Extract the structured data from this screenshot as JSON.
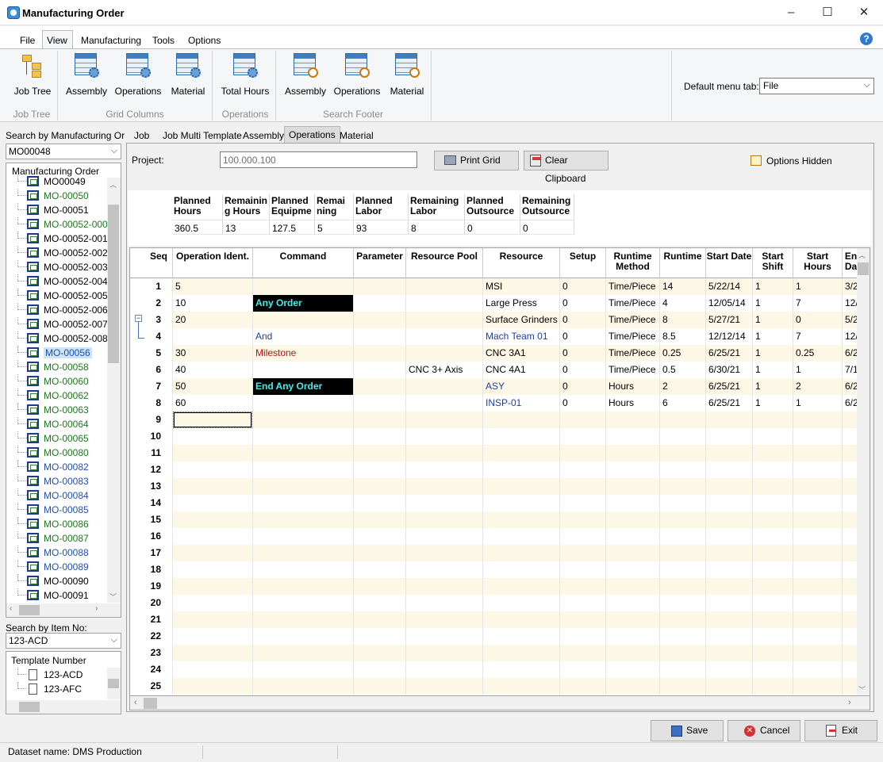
{
  "window": {
    "title": "Manufacturing Order",
    "min": "–",
    "max": "☐",
    "close": "✕"
  },
  "menu": {
    "file": "File",
    "view": "View",
    "manufacturing": "Manufacturing",
    "tools": "Tools",
    "options": "Options",
    "help": "?"
  },
  "ribbon": {
    "job_tree": "Job Tree",
    "job_tree_group": "Job Tree",
    "grid_assembly": "Assembly",
    "grid_operations": "Operations",
    "grid_material": "Material",
    "grid_group": "Grid Columns",
    "total_hours": "Total Hours",
    "ops_group": "Operations",
    "sf_assembly": "Assembly",
    "sf_operations": "Operations",
    "sf_material": "Material",
    "sf_group": "Search Footer",
    "default_tab_label": "Default menu tab:",
    "default_tab_value": "File"
  },
  "left": {
    "search_mo_label": "Search by Manufacturing Orde",
    "search_mo_value": "MO00048",
    "tree_header": "Manufacturing Order",
    "items": [
      {
        "text": "MO00049",
        "color": "#000"
      },
      {
        "text": "MO-00050",
        "color": "#1a7a1a"
      },
      {
        "text": "MO-00051",
        "color": "#000"
      },
      {
        "text": "MO-00052-000",
        "color": "#1a7a1a"
      },
      {
        "text": "MO-00052-001",
        "color": "#000"
      },
      {
        "text": "MO-00052-002",
        "color": "#000"
      },
      {
        "text": "MO-00052-003",
        "color": "#000"
      },
      {
        "text": "MO-00052-004",
        "color": "#000"
      },
      {
        "text": "MO-00052-005",
        "color": "#000"
      },
      {
        "text": "MO-00052-006",
        "color": "#000"
      },
      {
        "text": "MO-00052-007",
        "color": "#000"
      },
      {
        "text": "MO-00052-008",
        "color": "#000"
      },
      {
        "text": "MO-00056",
        "color": "#1f4fb0"
      },
      {
        "text": "MO-00058",
        "color": "#1a7a1a"
      },
      {
        "text": "MO-00060",
        "color": "#1a7a1a"
      },
      {
        "text": "MO-00062",
        "color": "#1a7a1a"
      },
      {
        "text": "MO-00063",
        "color": "#1a7a1a"
      },
      {
        "text": "MO-00064",
        "color": "#1a7a1a"
      },
      {
        "text": "MO-00065",
        "color": "#1a7a1a"
      },
      {
        "text": "MO-00080",
        "color": "#1a7a1a"
      },
      {
        "text": "MO-00082",
        "color": "#1f4fb0"
      },
      {
        "text": "MO-00083",
        "color": "#1f4fb0"
      },
      {
        "text": "MO-00084",
        "color": "#1f4fb0"
      },
      {
        "text": "MO-00085",
        "color": "#1f4fb0"
      },
      {
        "text": "MO-00086",
        "color": "#1a7a1a"
      },
      {
        "text": "MO-00087",
        "color": "#1a7a1a"
      },
      {
        "text": "MO-00088",
        "color": "#1f4fb0"
      },
      {
        "text": "MO-00089",
        "color": "#1f4fb0"
      },
      {
        "text": "MO-00090",
        "color": "#000"
      },
      {
        "text": "MO-00091",
        "color": "#000"
      }
    ],
    "search_item_label": "Search by Item No:",
    "search_item_value": "123-ACD",
    "template_header": "Template Number",
    "templates": [
      "123-ACD",
      "123-AFC"
    ]
  },
  "tabs": [
    "Job",
    "Job Multi Template",
    "Assembly",
    "Operations",
    "Material"
  ],
  "toolbar": {
    "project_label": "Project:",
    "project_value": "100.000.100",
    "print": "Print Grid",
    "clear": "Clear Clipboard",
    "options_hidden": "Options Hidden"
  },
  "summary": {
    "headers": [
      "Planned Hours",
      "Remainin g Hours",
      "Planned Equipme",
      "Remai ning",
      "Planned Labor",
      "Remaining Labor",
      "Planned Outsource",
      "Remaining Outsource"
    ],
    "values": [
      "360.5",
      "13",
      "127.5",
      "5",
      "93",
      "8",
      "0",
      "0"
    ]
  },
  "grid": {
    "columns": [
      "Seq",
      "Operation Ident.",
      "Command",
      "Parameter",
      "Resource Pool",
      "Resource",
      "Setup",
      "Runtime Method",
      "Runtime",
      "Start Date",
      "Start Shift",
      "Start Hours",
      "En Da"
    ],
    "rows": [
      {
        "seq": "1",
        "op": "5",
        "cmd": "",
        "param": "",
        "pool": "",
        "res": "MSI",
        "setup": "0",
        "method": "Time/Piece",
        "runtime": "14",
        "date": "5/22/14",
        "shift": "1",
        "hours": "1",
        "end": "3/2"
      },
      {
        "seq": "2",
        "op": "10",
        "cmd": "Any Order",
        "param": "",
        "pool": "",
        "res": "Large Press",
        "setup": "0",
        "method": "Time/Piece",
        "runtime": "4",
        "date": "12/05/14",
        "shift": "1",
        "hours": "7",
        "end": "12/"
      },
      {
        "seq": "3",
        "op": "20",
        "cmd": "",
        "param": "",
        "pool": "",
        "res": "Surface Grinders",
        "setup": "0",
        "method": "Time/Piece",
        "runtime": "8",
        "date": "5/27/21",
        "shift": "1",
        "hours": "0",
        "end": "5/2"
      },
      {
        "seq": "4",
        "op": "",
        "cmd": "And",
        "param": "",
        "pool": "",
        "res": "Mach Team 01",
        "setup": "0",
        "method": "Time/Piece",
        "runtime": "8.5",
        "date": "12/12/14",
        "shift": "1",
        "hours": "7",
        "end": "12/"
      },
      {
        "seq": "5",
        "op": "30",
        "cmd": "Milestone",
        "param": "",
        "pool": "",
        "res": "CNC 3A1",
        "setup": "0",
        "method": "Time/Piece",
        "runtime": "0.25",
        "date": "6/25/21",
        "shift": "1",
        "hours": "0.25",
        "end": "6/2"
      },
      {
        "seq": "6",
        "op": "40",
        "cmd": "",
        "param": "",
        "pool": "CNC 3+ Axis",
        "res": "CNC 4A1",
        "setup": "0",
        "method": "Time/Piece",
        "runtime": "0.5",
        "date": "6/30/21",
        "shift": "1",
        "hours": "1",
        "end": "7/1"
      },
      {
        "seq": "7",
        "op": "50",
        "cmd": "End Any Order",
        "param": "",
        "pool": "",
        "res": "ASY",
        "setup": "0",
        "method": "Hours",
        "runtime": "2",
        "date": "6/25/21",
        "shift": "1",
        "hours": "2",
        "end": "6/2"
      },
      {
        "seq": "8",
        "op": "60",
        "cmd": "",
        "param": "",
        "pool": "",
        "res": "INSP-01",
        "setup": "0",
        "method": "Hours",
        "runtime": "6",
        "date": "6/25/21",
        "shift": "1",
        "hours": "1",
        "end": "6/2"
      },
      {
        "seq": "9"
      },
      {
        "seq": "10"
      },
      {
        "seq": "11"
      },
      {
        "seq": "12"
      },
      {
        "seq": "13"
      },
      {
        "seq": "14"
      },
      {
        "seq": "15"
      },
      {
        "seq": "16"
      },
      {
        "seq": "17"
      },
      {
        "seq": "18"
      },
      {
        "seq": "19"
      },
      {
        "seq": "20"
      },
      {
        "seq": "21"
      },
      {
        "seq": "22"
      },
      {
        "seq": "23"
      },
      {
        "seq": "24"
      },
      {
        "seq": "25"
      }
    ]
  },
  "buttons": {
    "save": "Save",
    "cancel": "Cancel",
    "exit": "Exit"
  },
  "status": {
    "dataset": "Dataset name:  DMS Production"
  },
  "colors": {
    "row_alt": "#fdf7e6",
    "selected_tree": "#cce4f7",
    "command_block": "#000000",
    "command_text": "#3ff0f0",
    "blue_text": "#1f3fa0",
    "red_text": "#c01010"
  }
}
